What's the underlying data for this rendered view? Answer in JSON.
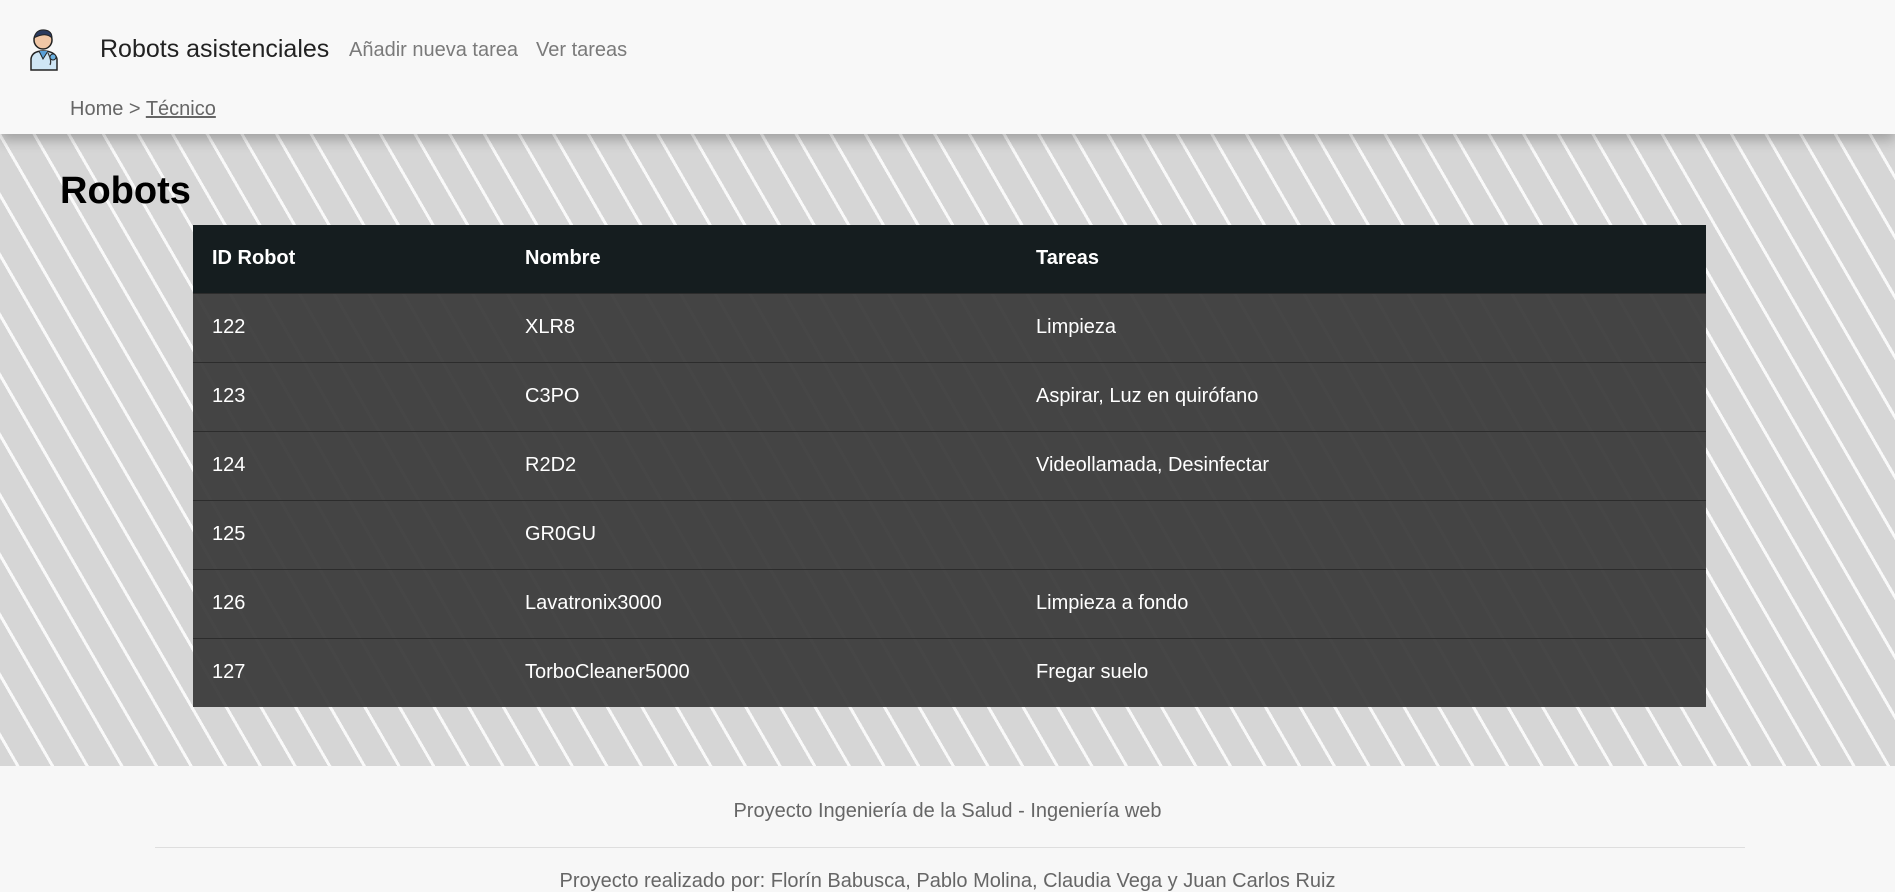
{
  "header": {
    "brand": "Robots asistenciales",
    "nav": {
      "add_task": "Añadir nueva tarea",
      "view_tasks": "Ver tareas"
    },
    "logo_icon": "doctor-avatar-icon",
    "breadcrumb": {
      "home": "Home",
      "separator": ">",
      "current": "Técnico"
    }
  },
  "main": {
    "title": "Robots",
    "table": {
      "headers": [
        "ID Robot",
        "Nombre",
        "Tareas"
      ],
      "rows": [
        [
          "122",
          "XLR8",
          "Limpieza"
        ],
        [
          "123",
          "C3PO",
          "Aspirar, Luz en quirófano"
        ],
        [
          "124",
          "R2D2",
          "Videollamada, Desinfectar"
        ],
        [
          "125",
          "GR0GU",
          ""
        ],
        [
          "126",
          "Lavatronix3000",
          "Limpieza a fondo"
        ],
        [
          "127",
          "TorboCleaner5000",
          "Fregar suelo"
        ]
      ]
    }
  },
  "footer": {
    "line1": "Proyecto Ingeniería de la Salud - Ingeniería web",
    "line2": "Proyecto realizado por: Florín Babusca, Pablo Molina, Claudia Vega y Juan Carlos Ruiz"
  }
}
